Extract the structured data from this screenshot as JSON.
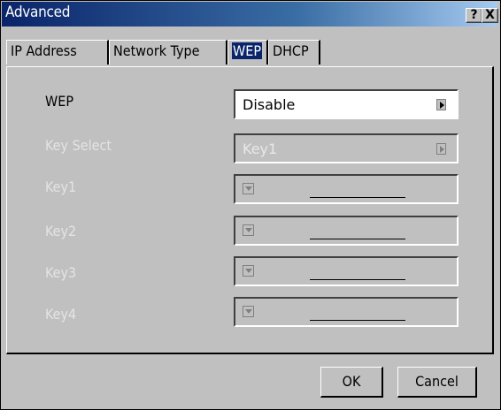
{
  "window": {
    "title": "Advanced",
    "help_glyph": "?",
    "close_glyph": "X"
  },
  "tabs": [
    {
      "label": "IP Address",
      "selected": false
    },
    {
      "label": "Network Type",
      "selected": false
    },
    {
      "label": "WEP",
      "selected": true
    },
    {
      "label": "DHCP",
      "selected": false
    }
  ],
  "form": {
    "wep": {
      "label": "WEP",
      "value": "Disable",
      "enabled": true
    },
    "key_select": {
      "label": "Key Select",
      "value": "Key1",
      "enabled": false
    },
    "key1": {
      "label": "Key1",
      "value": "",
      "enabled": false
    },
    "key2": {
      "label": "Key2",
      "value": "",
      "enabled": false
    },
    "key3": {
      "label": "Key3",
      "value": "",
      "enabled": false
    },
    "key4": {
      "label": "Key4",
      "value": "",
      "enabled": false
    }
  },
  "buttons": {
    "ok": "OK",
    "cancel": "Cancel"
  },
  "icons": {
    "help": "help-icon",
    "close": "close-icon",
    "right_arrow": "triangle-right-icon",
    "down_arrow": "triangle-down-icon"
  },
  "colors": {
    "title_start": "#0a246a",
    "title_end": "#a6caf0",
    "face": "#c0c0c0",
    "disabled_text": "#e4e4e4"
  }
}
